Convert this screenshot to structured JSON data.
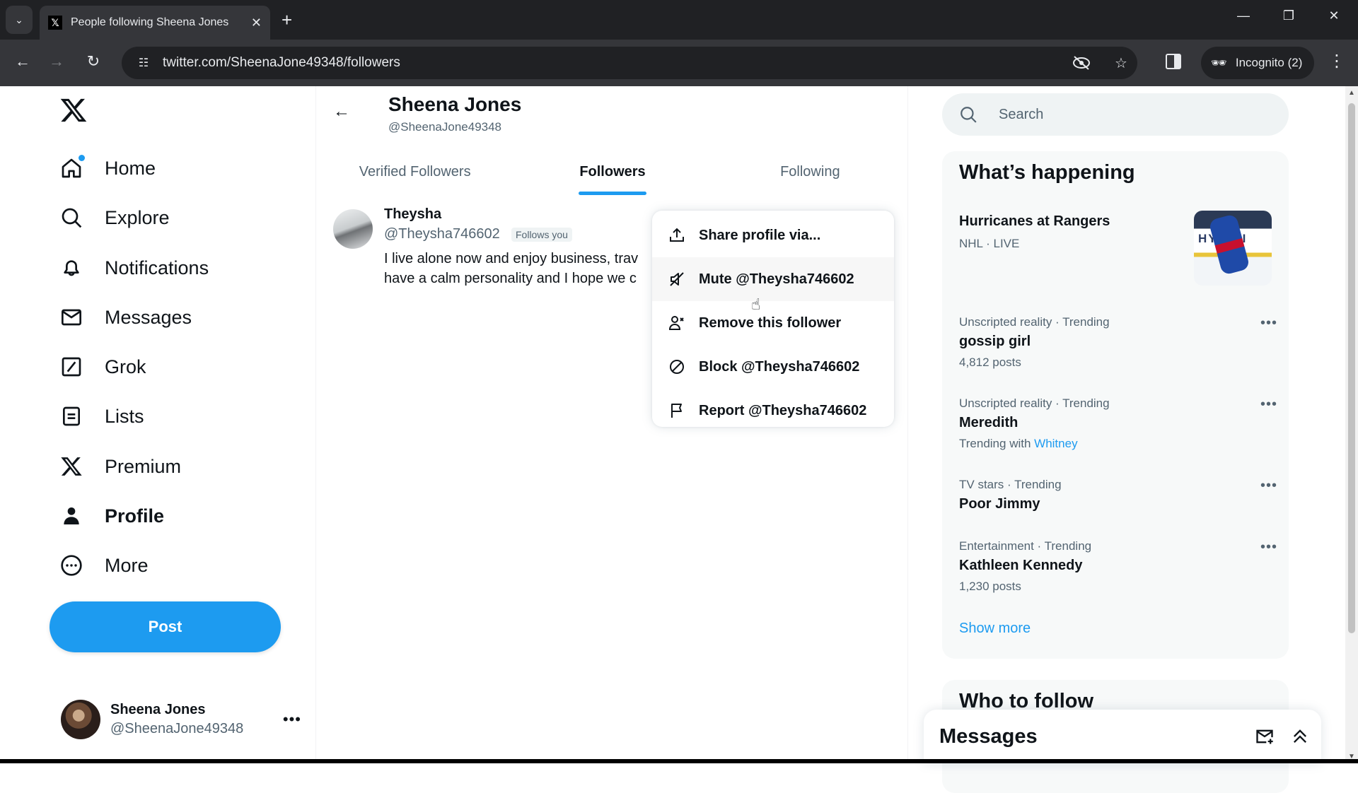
{
  "browser": {
    "tab_title": "People following Sheena Jones",
    "url": "twitter.com/SheenaJone49348/followers",
    "incognito_label": "Incognito (2)"
  },
  "sidebar": {
    "items": [
      {
        "label": "Home",
        "icon": "home-icon"
      },
      {
        "label": "Explore",
        "icon": "search-icon"
      },
      {
        "label": "Notifications",
        "icon": "bell-icon"
      },
      {
        "label": "Messages",
        "icon": "envelope-icon"
      },
      {
        "label": "Grok",
        "icon": "grok-icon"
      },
      {
        "label": "Lists",
        "icon": "list-icon"
      },
      {
        "label": "Premium",
        "icon": "x-logo-icon"
      },
      {
        "label": "Profile",
        "icon": "person-icon"
      },
      {
        "label": "More",
        "icon": "more-circle-icon"
      }
    ],
    "post_label": "Post",
    "account": {
      "name": "Sheena Jones",
      "handle": "@SheenaJone49348"
    }
  },
  "main": {
    "header": {
      "name": "Sheena Jones",
      "handle": "@SheenaJone49348"
    },
    "tabs": [
      {
        "label": "Verified Followers",
        "active": false
      },
      {
        "label": "Followers",
        "active": true
      },
      {
        "label": "Following",
        "active": false
      }
    ],
    "followers": [
      {
        "name": "Theysha",
        "handle": "@Theysha746602",
        "badge": "Follows you",
        "bio_line1": "I live alone now and enjoy business, trav",
        "bio_line2": "have a calm personality and I hope we c"
      }
    ],
    "context_menu": [
      {
        "label": "Share profile via...",
        "icon": "share-icon"
      },
      {
        "label": "Mute @Theysha746602",
        "icon": "mute-icon"
      },
      {
        "label": "Remove this follower",
        "icon": "remove-user-icon"
      },
      {
        "label": "Block @Theysha746602",
        "icon": "block-icon"
      },
      {
        "label": "Report @Theysha746602",
        "icon": "flag-icon"
      }
    ]
  },
  "right": {
    "search_placeholder": "Search",
    "trends_title": "What’s happening",
    "live": {
      "title": "Hurricanes at Rangers",
      "meta": "NHL · LIVE"
    },
    "trends": [
      {
        "category": "Unscripted reality · Trending",
        "title": "gossip girl",
        "sub": "4,812 posts"
      },
      {
        "category": "Unscripted reality · Trending",
        "title": "Meredith",
        "sub": "Trending with",
        "link": "Whitney"
      },
      {
        "category": "TV stars · Trending",
        "title": "Poor Jimmy",
        "sub": ""
      },
      {
        "category": "Entertainment · Trending",
        "title": "Kathleen Kennedy",
        "sub": "1,230 posts"
      }
    ],
    "show_more": "Show more",
    "who_to_follow": "Who to follow",
    "messages_drawer": "Messages"
  },
  "colors": {
    "accent": "#1d9bf0",
    "text": "#0f1419",
    "muted": "#536471"
  }
}
